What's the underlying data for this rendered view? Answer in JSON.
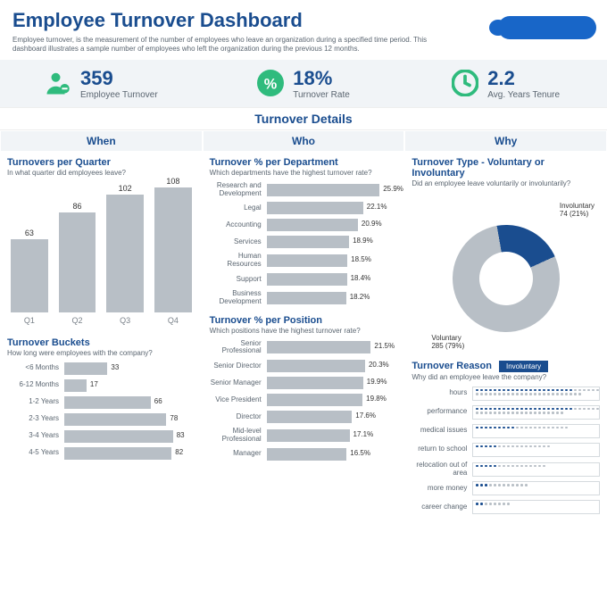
{
  "header": {
    "title": "Employee Turnover Dashboard",
    "subtitle": "Employee turnover, is the measurement of the number of employees who leave an organization during a specified time period. This dashboard illustrates a sample number of employees who left the organization during the previous 12 months."
  },
  "kpis": {
    "turnover": {
      "value": "359",
      "label": "Employee Turnover"
    },
    "rate": {
      "value": "18%",
      "label": "Turnover Rate"
    },
    "tenure": {
      "value": "2.2",
      "label": "Avg. Years Tenure"
    }
  },
  "details_label": "Turnover Details",
  "tabs": [
    "When",
    "Who",
    "Why"
  ],
  "when": {
    "quarters": {
      "title": "Turnovers per Quarter",
      "subtitle": "In what quarter did employees leave?"
    },
    "buckets": {
      "title": "Turnover Buckets",
      "subtitle": "How long were employees with the company?"
    }
  },
  "who": {
    "dept": {
      "title": "Turnover % per Department",
      "subtitle": "Which departments have the highest turnover rate?"
    },
    "pos": {
      "title": "Turnover % per Position",
      "subtitle": "Which positions have the highest turnover rate?"
    }
  },
  "why": {
    "type": {
      "title": "Turnover Type - Voluntary or Involuntary",
      "subtitle": "Did an employee leave voluntarily or involuntarily?",
      "involuntary_label": "Involuntary\n74 (21%)",
      "voluntary_label": "Voluntary\n285 (79%)"
    },
    "reason": {
      "title": "Turnover Reason",
      "subtitle": "Why did an employee leave the company?",
      "pill": "Involuntary"
    }
  },
  "chart_data": [
    {
      "name": "turnovers_per_quarter",
      "type": "bar",
      "categories": [
        "Q1",
        "Q2",
        "Q3",
        "Q4"
      ],
      "values": [
        63,
        86,
        102,
        108
      ],
      "title": "Turnovers per Quarter"
    },
    {
      "name": "turnover_buckets",
      "type": "bar",
      "orientation": "horizontal",
      "categories": [
        "<6 Months",
        "6-12 Months",
        "1-2 Years",
        "2-3 Years",
        "3-4 Years",
        "4-5 Years"
      ],
      "values": [
        33,
        17,
        66,
        78,
        83,
        82
      ],
      "title": "Turnover Buckets"
    },
    {
      "name": "turnover_pct_department",
      "type": "bar",
      "orientation": "horizontal",
      "categories": [
        "Research and Development",
        "Legal",
        "Accounting",
        "Services",
        "Human Resources",
        "Support",
        "Business Development"
      ],
      "values": [
        25.9,
        22.1,
        20.9,
        18.9,
        18.5,
        18.4,
        18.2
      ],
      "value_suffix": "%",
      "title": "Turnover % per Department"
    },
    {
      "name": "turnover_pct_position",
      "type": "bar",
      "orientation": "horizontal",
      "categories": [
        "Senior Professional",
        "Senior Director",
        "Senior Manager",
        "Vice President",
        "Director",
        "Mid-level Professional",
        "Manager"
      ],
      "values": [
        21.5,
        20.3,
        19.9,
        19.8,
        17.6,
        17.1,
        16.5
      ],
      "value_suffix": "%",
      "title": "Turnover % per Position"
    },
    {
      "name": "turnover_type",
      "type": "pie",
      "categories": [
        "Involuntary",
        "Voluntary"
      ],
      "values": [
        74,
        285
      ],
      "percents": [
        21,
        79
      ],
      "title": "Turnover Type - Voluntary or Involuntary"
    },
    {
      "name": "turnover_reason",
      "type": "bar",
      "orientation": "horizontal",
      "categories": [
        "hours",
        "performance",
        "medical issues",
        "return to school",
        "relocation out of area",
        "more money",
        "career change"
      ],
      "series": [
        {
          "name": "Involuntary",
          "values": [
            22,
            22,
            9,
            5,
            5,
            3,
            2
          ]
        },
        {
          "name": "Voluntary",
          "values": [
            30,
            26,
            12,
            12,
            11,
            9,
            6
          ]
        }
      ],
      "title": "Turnover Reason"
    }
  ]
}
